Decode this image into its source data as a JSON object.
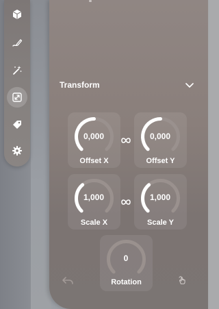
{
  "sidebar": {
    "items": [
      {
        "icon": "cube-icon"
      },
      {
        "icon": "pencil-draw-icon"
      },
      {
        "icon": "magic-wand-icon"
      },
      {
        "icon": "resize-icon",
        "active": true
      },
      {
        "icon": "tag-icon"
      },
      {
        "icon": "gear-icon"
      }
    ]
  },
  "transform": {
    "title": "Transform",
    "offset_x": {
      "label": "Offset X",
      "value": "0,000",
      "fraction": 0.5
    },
    "offset_y": {
      "label": "Offset Y",
      "value": "0,000",
      "fraction": 0.5
    },
    "scale_x": {
      "label": "Scale X",
      "value": "1,000",
      "fraction": 0.35
    },
    "scale_y": {
      "label": "Scale Y",
      "value": "1,000",
      "fraction": 0.35
    },
    "rotation": {
      "label": "Rotation",
      "value": "0",
      "fraction": 0.0
    }
  },
  "colors": {
    "panel": "#8a7f7b",
    "text": "#ffffff",
    "dial_track": "#9a918e"
  },
  "bottom_bar": {
    "left_icon": "undo-icon",
    "right_icon": "hand-pointer-icon"
  }
}
